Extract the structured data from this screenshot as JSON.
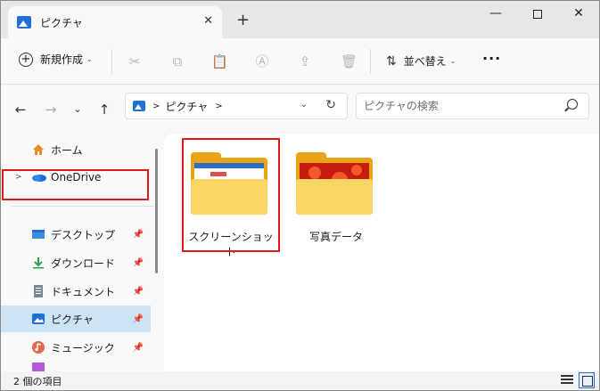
{
  "window": {
    "tab_title": "ピクチャ",
    "tab_close": "✕",
    "new_tab": "+",
    "minimize": "—",
    "close": "✕"
  },
  "commandbar": {
    "new_label": "新規作成",
    "new_chevron": "⌄",
    "sort_label": "並べ替え",
    "sort_chevron": "⌄",
    "more": "···",
    "icons": [
      "cut-icon",
      "copy-icon",
      "paste-icon",
      "rename-icon",
      "share-icon",
      "delete-icon"
    ]
  },
  "navigation": {
    "back": "←",
    "forward": "→",
    "recent": "⌄",
    "up": "↑",
    "address_sep1": ">",
    "address_path": "ピクチャ",
    "address_sep2": ">",
    "address_dropdown": "⌄",
    "refresh": "↻",
    "search_placeholder": "ピクチャの検索"
  },
  "sidebar": {
    "items": [
      {
        "label": "ホーム",
        "icon": "home-icon",
        "pinned": false
      },
      {
        "label": "OneDrive",
        "icon": "onedrive-icon",
        "pinned": false,
        "chevron": ">"
      },
      {
        "label": "デスクトップ",
        "icon": "desktop-icon",
        "pinned": true
      },
      {
        "label": "ダウンロード",
        "icon": "download-icon",
        "pinned": true
      },
      {
        "label": "ドキュメント",
        "icon": "documents-icon",
        "pinned": true
      },
      {
        "label": "ピクチャ",
        "icon": "pictures-icon",
        "pinned": true,
        "selected": true
      },
      {
        "label": "ミュージック",
        "icon": "music-icon",
        "pinned": true
      }
    ],
    "pin_glyph": "📌"
  },
  "folders": [
    {
      "label": "スクリーンショット",
      "highlighted": true
    },
    {
      "label": "写真データ",
      "highlighted": false
    }
  ],
  "status": {
    "item_count": "2 個の項目"
  },
  "colors": {
    "accent": "#1f6fd6",
    "highlight_box": "#e0191b",
    "selection": "#cde4f7",
    "folder": "#fcd567"
  }
}
